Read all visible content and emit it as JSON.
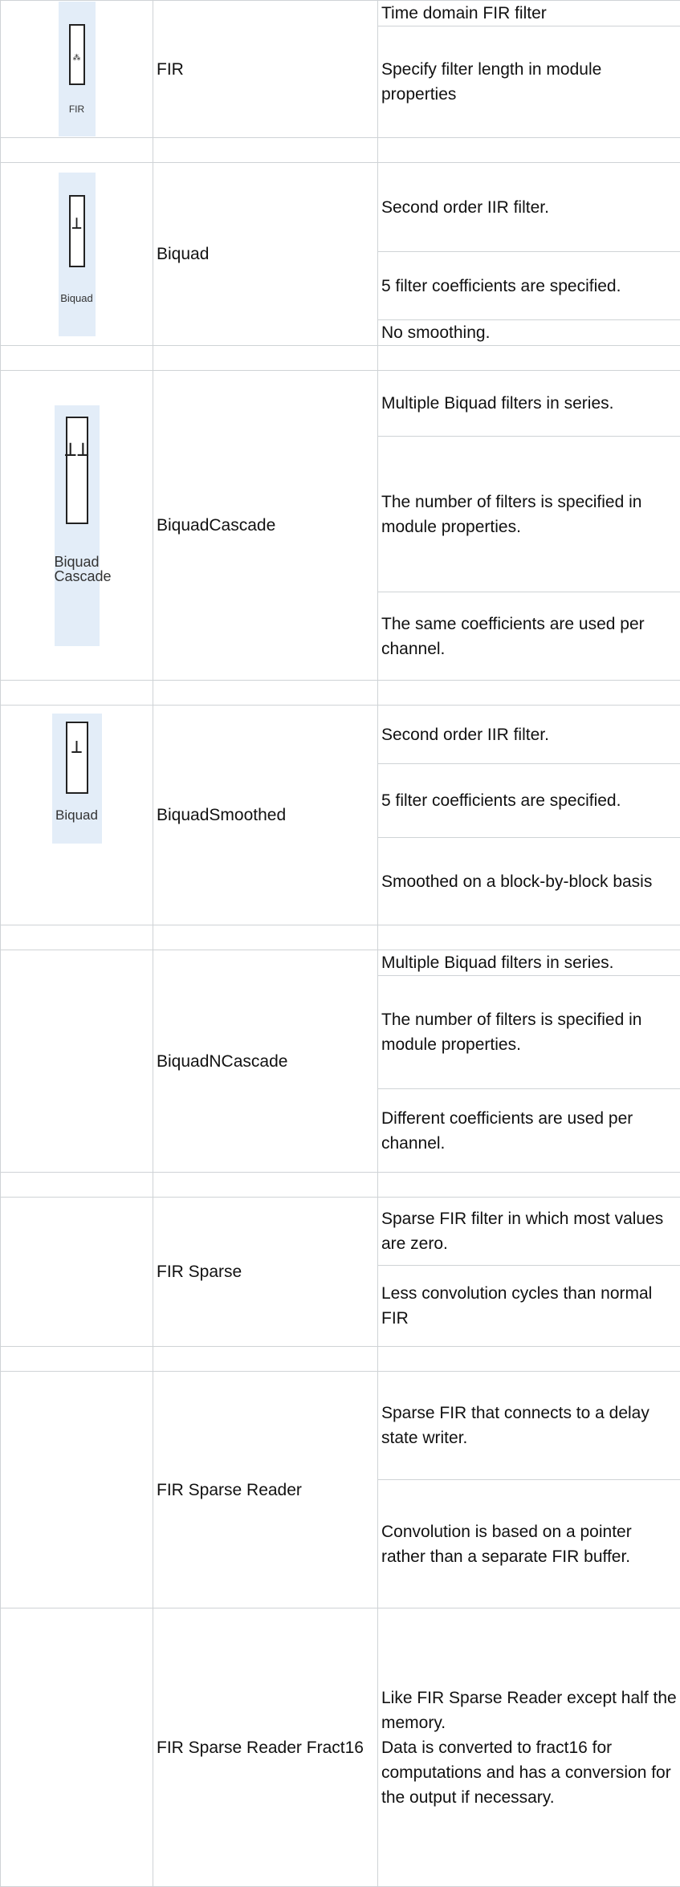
{
  "rows": [
    {
      "name": "FIR",
      "icon_name": "fir-module-icon",
      "icon_label": "FIR",
      "descriptions": [
        "Time domain FIR filter",
        "Specify filter length in module properties"
      ]
    },
    {
      "name": "Biquad",
      "icon_name": "biquad-module-icon",
      "icon_label": "Biquad",
      "descriptions": [
        "Second order IIR filter.",
        "5 filter coefficients are specified.",
        "No smoothing."
      ]
    },
    {
      "name": "BiquadCascade",
      "icon_name": "biquad-cascade-module-icon",
      "icon_label": "Biquad Cascade",
      "descriptions": [
        "Multiple Biquad filters in series.",
        "The number of filters is specified in module properties.",
        "The same coefficients are used per channel."
      ]
    },
    {
      "name": "BiquadSmoothed",
      "icon_name": "biquad-smoothed-module-icon",
      "icon_label": "Biquad",
      "descriptions": [
        "Second order IIR filter.",
        "5 filter coefficients are specified.",
        "Smoothed on a block-by-block basis"
      ]
    },
    {
      "name": "BiquadNCascade",
      "descriptions": [
        "Multiple Biquad filters in series.",
        "The number of filters is specified in module properties.",
        "Different coefficients are used per channel."
      ]
    },
    {
      "name": "FIR Sparse",
      "descriptions": [
        "Sparse FIR filter in which most values are zero.",
        "Less convolution cycles than normal FIR"
      ]
    },
    {
      "name": "FIR Sparse Reader",
      "descriptions": [
        "Sparse FIR that connects to a delay state writer.",
        "Convolution is based on a pointer rather than a separate FIR buffer."
      ]
    },
    {
      "name": "FIR Sparse Reader Fract16",
      "descriptions": [
        "Like FIR Sparse Reader except half the memory.\nData is converted to fract16 for computations and has a conversion for the output if necessary."
      ]
    }
  ]
}
